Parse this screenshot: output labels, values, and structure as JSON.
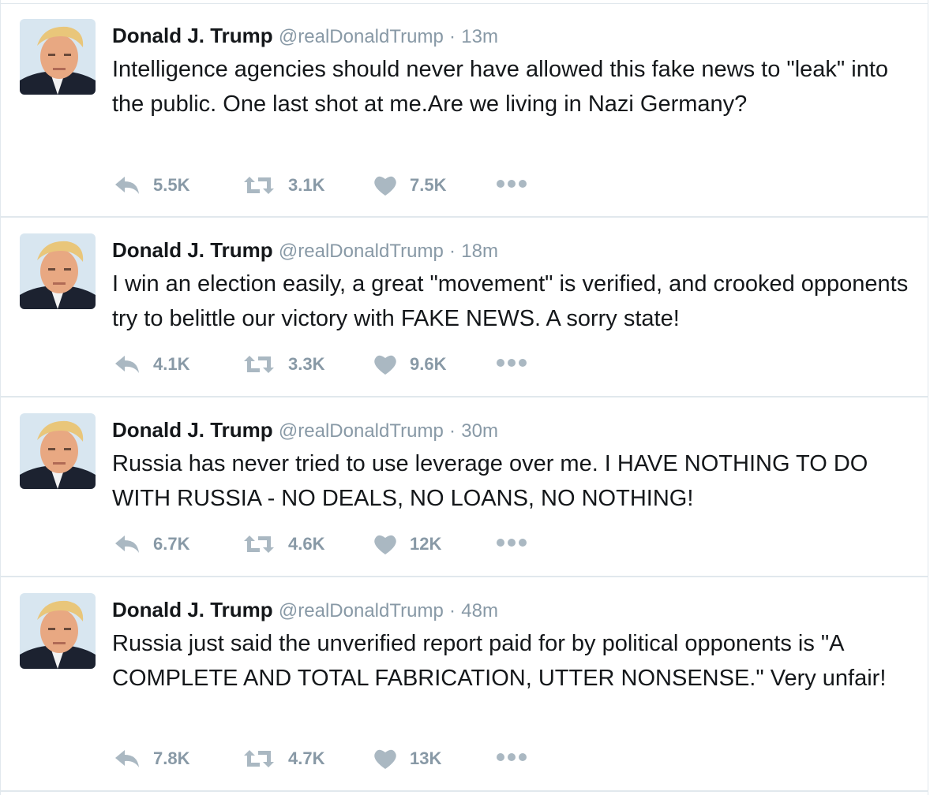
{
  "tweets": [
    {
      "fullname": "Donald J. Trump",
      "username": "@realDonaldTrump",
      "separator": "·",
      "time": "13m",
      "text": "Intelligence agencies should never have allowed this fake news to \"leak\" into the public. One last shot at me.Are we living in Nazi Germany?",
      "replies": "5.5K",
      "retweets": "3.1K",
      "likes": "7.5K"
    },
    {
      "fullname": "Donald J. Trump",
      "username": "@realDonaldTrump",
      "separator": "·",
      "time": "18m",
      "text": "I win an election easily, a great \"movement\" is verified, and crooked opponents try to belittle our victory with FAKE NEWS. A sorry state!",
      "replies": "4.1K",
      "retweets": "3.3K",
      "likes": "9.6K"
    },
    {
      "fullname": "Donald J. Trump",
      "username": "@realDonaldTrump",
      "separator": "·",
      "time": "30m",
      "text": "Russia has never tried to use leverage over me. I HAVE NOTHING TO DO WITH RUSSIA - NO DEALS, NO LOANS, NO NOTHING!",
      "replies": "6.7K",
      "retweets": "4.6K",
      "likes": "12K"
    },
    {
      "fullname": "Donald J. Trump",
      "username": "@realDonaldTrump",
      "separator": "·",
      "time": "48m",
      "text": "Russia just said the unverified report paid for by political opponents is \"A COMPLETE AND TOTAL FABRICATION, UTTER NONSENSE.\" Very unfair!",
      "replies": "7.8K",
      "retweets": "4.7K",
      "likes": "13K"
    }
  ],
  "icons": {
    "reply": "reply-arrow-icon",
    "retweet": "retweet-icon",
    "like": "heart-icon",
    "more": "more-dots-icon"
  },
  "colors": {
    "text": "#14171a",
    "muted": "#8899a6",
    "icon": "#aab8c2",
    "divider": "#e1e8ed"
  }
}
